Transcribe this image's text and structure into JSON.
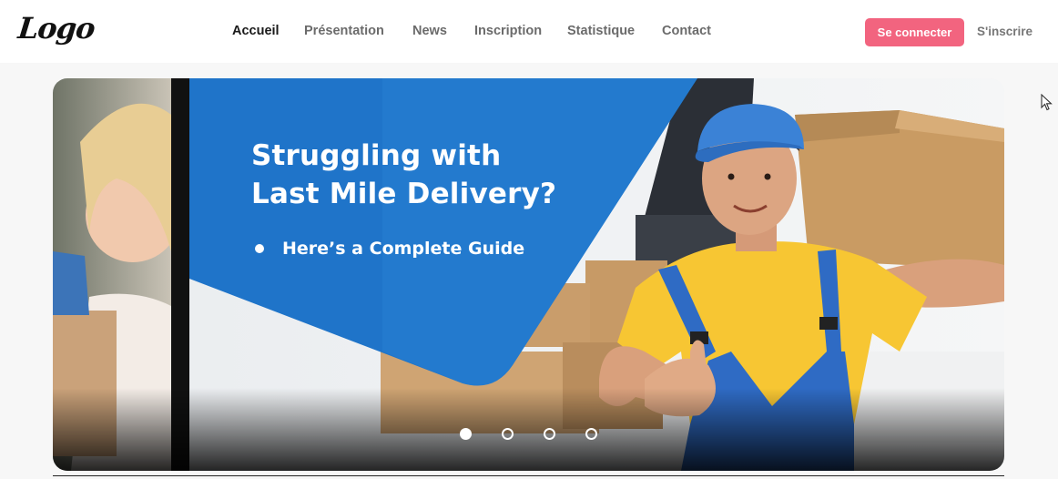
{
  "header": {
    "logo_text": "Logo",
    "nav": [
      {
        "label": "Accueil",
        "active": true
      },
      {
        "label": "Présentation",
        "active": false
      },
      {
        "label": "News",
        "active": false
      },
      {
        "label": "Inscription",
        "active": false
      },
      {
        "label": "Statistique",
        "active": false
      },
      {
        "label": "Contact",
        "active": false
      }
    ],
    "login_label": "Se connecter",
    "signup_label": "S'inscrire"
  },
  "hero": {
    "headline_line1": "Struggling with",
    "headline_line2": "Last Mile Delivery?",
    "bullet_text": "Here’s a Complete Guide",
    "slides_count": 4,
    "active_slide": 1
  },
  "colors": {
    "accent_pink": "#f2647f",
    "hero_blue": "#1f74c9",
    "shirt_yellow": "#f7c633",
    "overall_blue": "#2f6bc4"
  },
  "icons": [
    "pointer-cursor-icon"
  ]
}
